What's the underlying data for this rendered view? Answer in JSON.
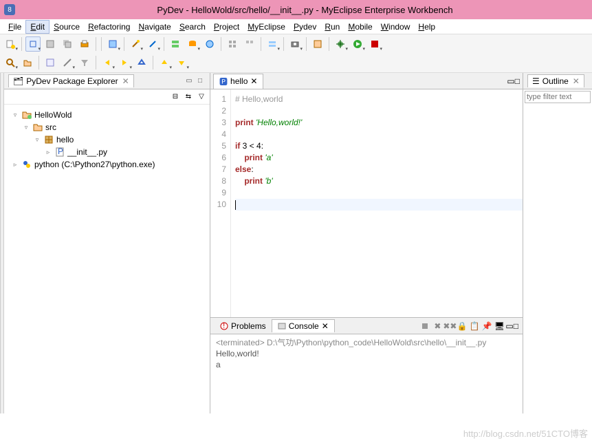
{
  "title": "PyDev - HelloWold/src/hello/__init__.py - MyEclipse Enterprise Workbench",
  "menu": {
    "items": [
      "File",
      "Edit",
      "Source",
      "Refactoring",
      "Navigate",
      "Search",
      "Project",
      "MyEclipse",
      "Pydev",
      "Run",
      "Mobile",
      "Window",
      "Help"
    ],
    "active": "Edit"
  },
  "sidebar": {
    "title": "PyDev Package Explorer",
    "tree": [
      {
        "depth": 0,
        "label": "HelloWold",
        "icon": "project",
        "exp": "▿"
      },
      {
        "depth": 1,
        "label": "src",
        "icon": "package-folder",
        "exp": "▿"
      },
      {
        "depth": 2,
        "label": "hello",
        "icon": "package",
        "exp": "▿"
      },
      {
        "depth": 3,
        "label": "__init__.py",
        "icon": "py",
        "exp": "▹"
      },
      {
        "depth": 0,
        "label": "python  (C:\\Python27\\python.exe)",
        "icon": "python",
        "exp": "▹"
      }
    ]
  },
  "editor": {
    "tab_label": "hello",
    "lines": [
      {
        "n": 1,
        "html": "<span class='comment'># Hello,world</span>"
      },
      {
        "n": 2,
        "html": ""
      },
      {
        "n": 3,
        "html": "<span class='kw'>print</span> <span class='str'>'Hello,world!'</span>"
      },
      {
        "n": 4,
        "html": ""
      },
      {
        "n": 5,
        "html": "<span class='kw'>if</span> 3 &lt; 4:"
      },
      {
        "n": 6,
        "html": "    <span class='kw'>print</span> <span class='str'>'a'</span>"
      },
      {
        "n": 7,
        "html": "<span class='kw'>else</span>:"
      },
      {
        "n": 8,
        "html": "    <span class='kw'>print</span> <span class='str'>'b'</span>"
      },
      {
        "n": 9,
        "html": ""
      },
      {
        "n": 10,
        "html": "<span class='cursor-caret'></span>",
        "current": true
      }
    ]
  },
  "bottom": {
    "tabs": [
      {
        "label": "Problems",
        "active": false
      },
      {
        "label": "Console",
        "active": true
      }
    ],
    "terminated_line": "<terminated> D:\\气功\\Python\\python_code\\HelloWold\\src\\hello\\__init__.py",
    "output_1": "Hello,world!",
    "output_2": "a"
  },
  "outline": {
    "title": "Outline",
    "filter_placeholder": "type filter text"
  },
  "watermark": "http://blog.csdn.net/51CTO博客"
}
